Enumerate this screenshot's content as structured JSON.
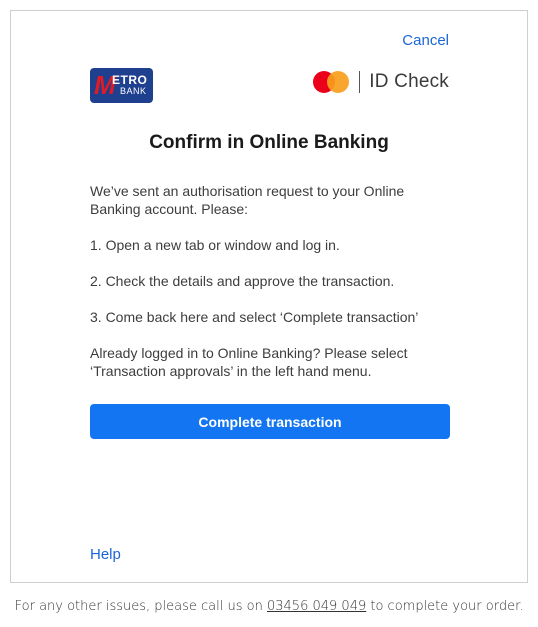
{
  "header": {
    "cancel_label": "Cancel",
    "bank_logo": {
      "m_letter": "M",
      "etro_text": "ETRO",
      "bank_text": "BANK",
      "bg_color": "#1f3f8f",
      "accent_color": "#e21b23"
    },
    "scheme_logo": {
      "icon": "mastercard-icon",
      "text": "ID Check"
    }
  },
  "main": {
    "title": "Confirm in Online Banking",
    "paragraphs": [
      "We’ve sent an authorisation request to your Online Banking account. Please:",
      "1. Open a new tab or window and log in.",
      "2. Check the details and approve the transaction.",
      "3. Come back here and select ‘Complete transaction’",
      "Already logged in to Online Banking? Please select ‘Transaction approvals’ in the left hand menu."
    ],
    "complete_button_label": "Complete transaction",
    "button_color": "#1375f2"
  },
  "help_label": "Help",
  "footer": {
    "text_before": "For any other issues, please call us on ",
    "phone": "03456 049 049",
    "text_after": " to complete your order."
  }
}
